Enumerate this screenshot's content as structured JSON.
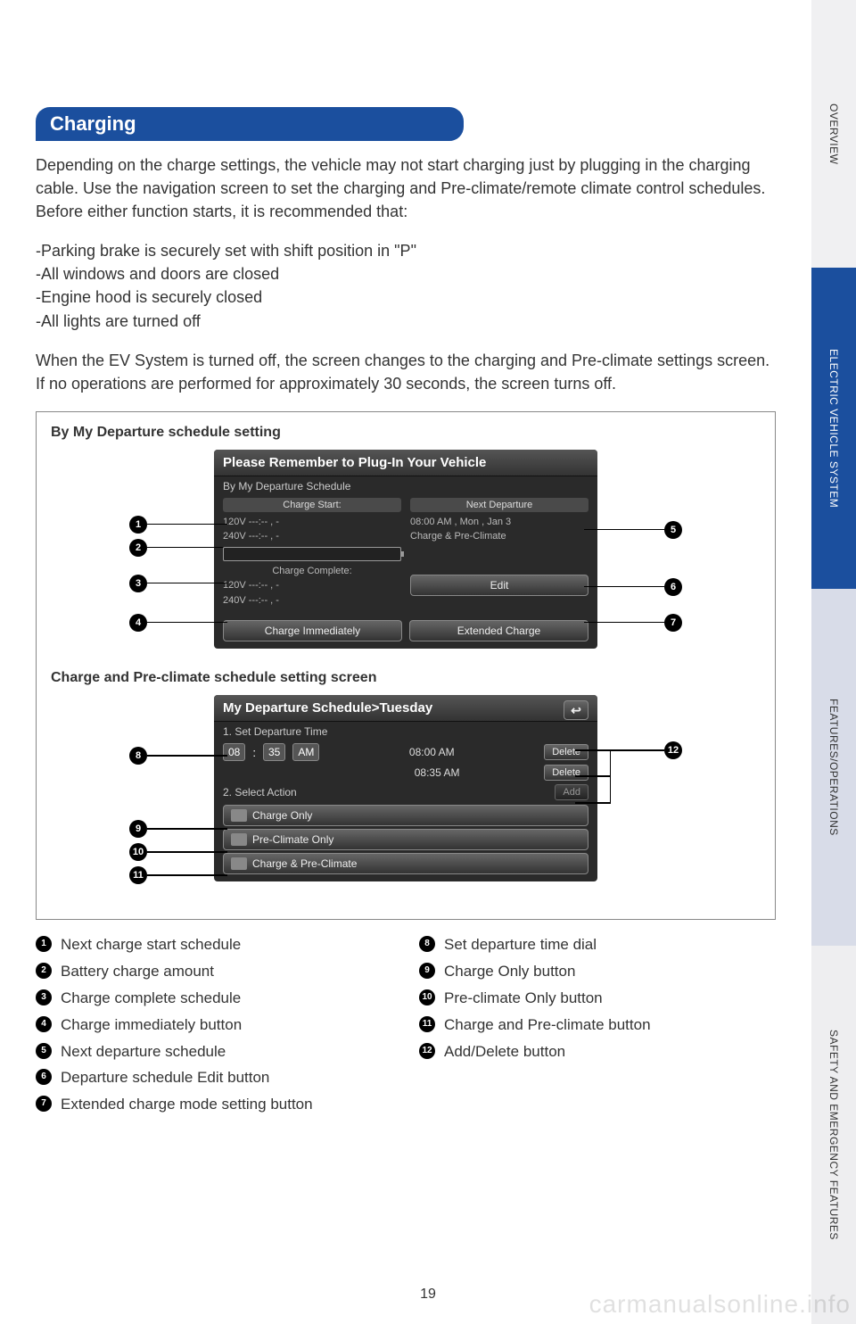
{
  "tabs": {
    "overview": "OVERVIEW",
    "ev": "ELECTRIC VEHICLE SYSTEM",
    "features": "FEATURES/OPERATIONS",
    "safety": "SAFETY AND EMERGENCY FEATURES"
  },
  "heading": "Charging",
  "intro": "Depending on the charge settings, the vehicle may not start charging just by plugging in the charging cable. Use the navigation screen to set the charging and Pre-climate/remote climate control schedules. Before either function starts, it is recommended that:",
  "bullets": {
    "b1": "-Parking brake is securely set with shift position in \"P\"",
    "b2": "-All windows and doors are closed",
    "b3": "-Engine hood is securely closed",
    "b4": "-All lights are turned off"
  },
  "para2": "When the EV System is turned off, the screen changes to the charging and Pre-climate settings screen. If no operations are performed for approximately 30 seconds, the screen turns off.",
  "diagram1": {
    "title": "By My Departure schedule setting",
    "header": "Please Remember to Plug-In Your Vehicle",
    "sub": "By My Departure Schedule",
    "col1_head": "Charge Start:",
    "c1l1": "120V ---:-- ,   -",
    "c1l2": "240V ---:-- ,   -",
    "col1_head2": "Charge Complete:",
    "c1l3": "120V ---:-- ,   -",
    "c1l4": "240V ---:-- ,   -",
    "col2_head": "Next Departure",
    "c2l1": "08:00 AM  , Mon ,  Jan  3",
    "c2l2": "Charge & Pre-Climate",
    "edit": "Edit",
    "btn1": "Charge Immediately",
    "btn2": "Extended Charge"
  },
  "diagram2": {
    "title": "Charge and Pre-climate schedule setting screen",
    "header": "My Departure Schedule>Tuesday",
    "step1": "1. Set Departure Time",
    "hh": "08",
    "mm": "35",
    "ampm": "AM",
    "t1": "08:00 AM",
    "t2": "08:35 AM",
    "delete": "Delete",
    "add": "Add",
    "step2": "2. Select Action",
    "a1": "Charge Only",
    "a2": "Pre-Climate Only",
    "a3": "Charge & Pre-Climate"
  },
  "legend": {
    "l1": "Next charge start schedule",
    "l2": "Battery charge amount",
    "l3": "Charge complete schedule",
    "l4": "Charge immediately button",
    "l5": "Next departure schedule",
    "l6": "Departure schedule Edit button",
    "l7": "Extended charge mode setting button",
    "l8": "Set departure time dial",
    "l9": "Charge Only button",
    "l10": "Pre-climate Only button",
    "l11": "Charge and Pre-climate button",
    "l12": "Add/Delete button"
  },
  "page_number": "19",
  "watermark": "carmanualsonline.info"
}
